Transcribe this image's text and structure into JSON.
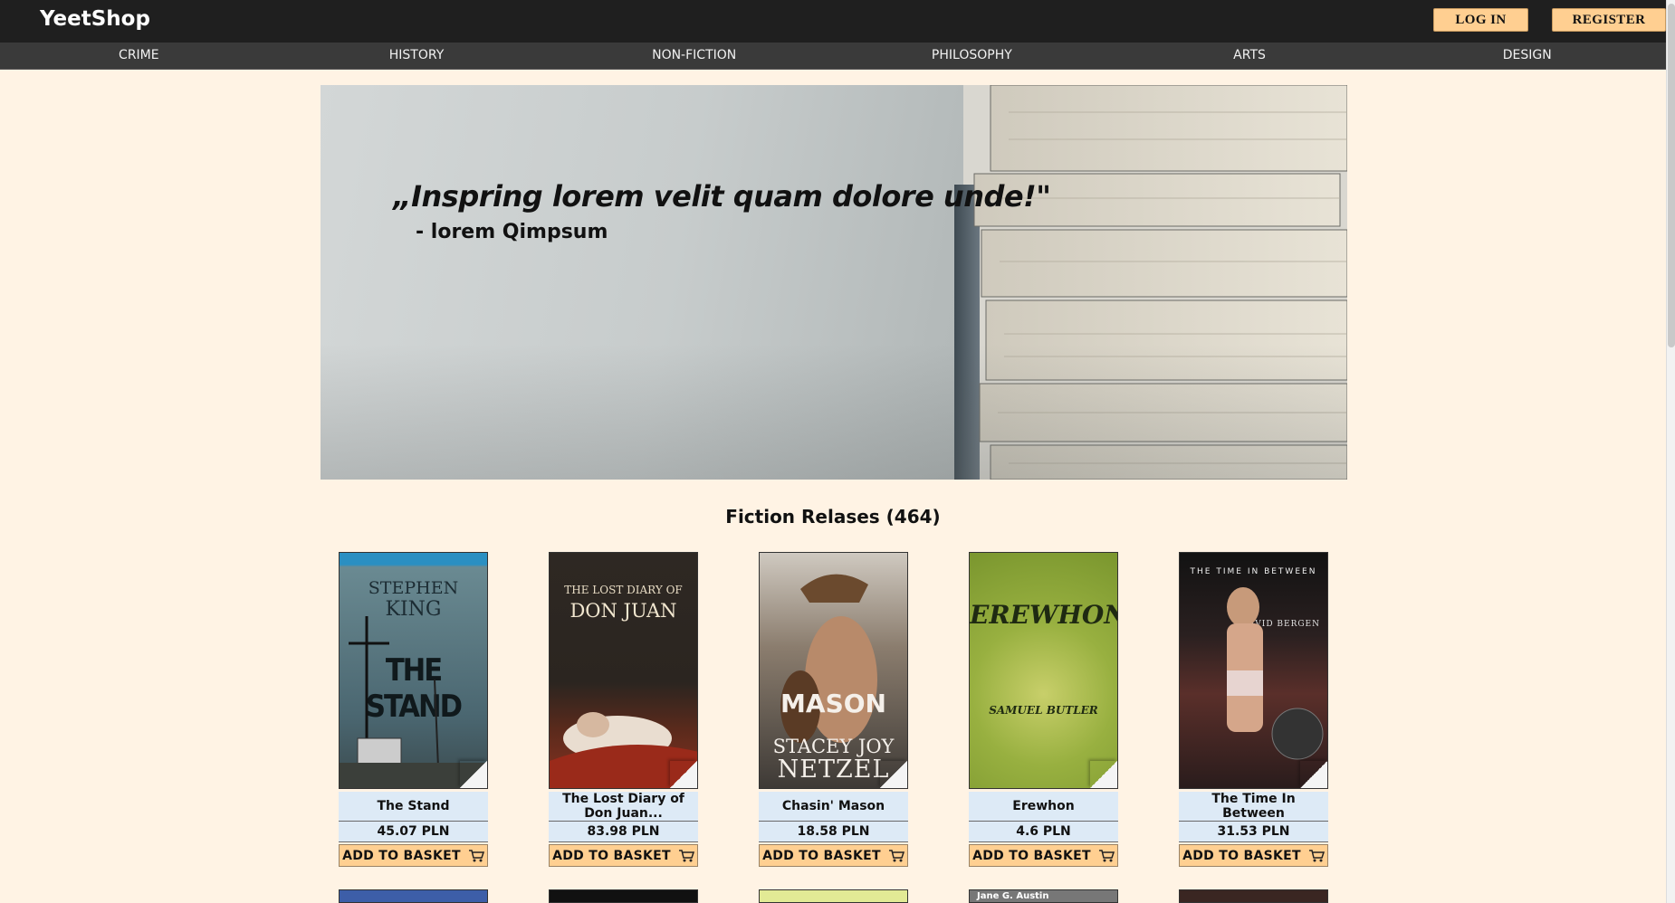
{
  "header": {
    "logo": "YeetShop",
    "login_label": "LOG IN",
    "register_label": "REGISTER"
  },
  "categories": [
    "CRIME",
    "HISTORY",
    "NON-FICTION",
    "PHILOSOPHY",
    "ARTS",
    "DESIGN"
  ],
  "hero": {
    "quote": "„Inspring lorem velit quam dolore unde!\"",
    "author": "- lorem Qimpsum"
  },
  "section": {
    "title": "Fiction Relases (464)"
  },
  "books": [
    {
      "title": "The Stand",
      "price": "45.07 PLN",
      "button": "ADD TO BASKET",
      "cover_lines": [
        "STEPHEN",
        "KING",
        "THE STAND"
      ],
      "cover_color": "#51767f"
    },
    {
      "title": "The Lost Diary of Don Juan...",
      "price": "83.98 PLN",
      "button": "ADD TO BASKET",
      "cover_lines": [
        "THE LOST DIARY OF",
        "DON JUAN"
      ],
      "cover_color": "#2b2520"
    },
    {
      "title": "Chasin' Mason",
      "price": "18.58 PLN",
      "button": "ADD TO BASKET",
      "cover_lines": [
        "MASON",
        "STACEY JOY",
        "NETZEL"
      ],
      "cover_color": "#6d6a66"
    },
    {
      "title": "Erewhon",
      "price": "4.6 PLN",
      "button": "ADD TO BASKET",
      "cover_lines": [
        "EREWHON",
        "SAMUEL BUTLER"
      ],
      "cover_color": "#8fa83c"
    },
    {
      "title": "The Time In Between",
      "price": "31.53 PLN",
      "button": "ADD TO BASKET",
      "cover_lines": [
        "THE TIME IN BETWEEN",
        "DAVID BERGEN"
      ],
      "cover_color": "#3b2a2a"
    }
  ],
  "next_row": {
    "covers": [
      {
        "color": "#3d5ea8",
        "label": ""
      },
      {
        "color": "#111111",
        "label": ""
      },
      {
        "color": "#e2ea95",
        "label": ""
      },
      {
        "color": "#777777",
        "label": "Jane G. Austin"
      },
      {
        "color": "#3a2622",
        "label": ""
      }
    ]
  },
  "icons": {
    "cart": "cart-icon"
  },
  "colors": {
    "topbar": "#1f1f1f",
    "catbar": "#3a3a3a",
    "page_bg": "#fff3e4",
    "button_accent": "#ffcf91",
    "card_label_bg": "#ddeaf6"
  }
}
